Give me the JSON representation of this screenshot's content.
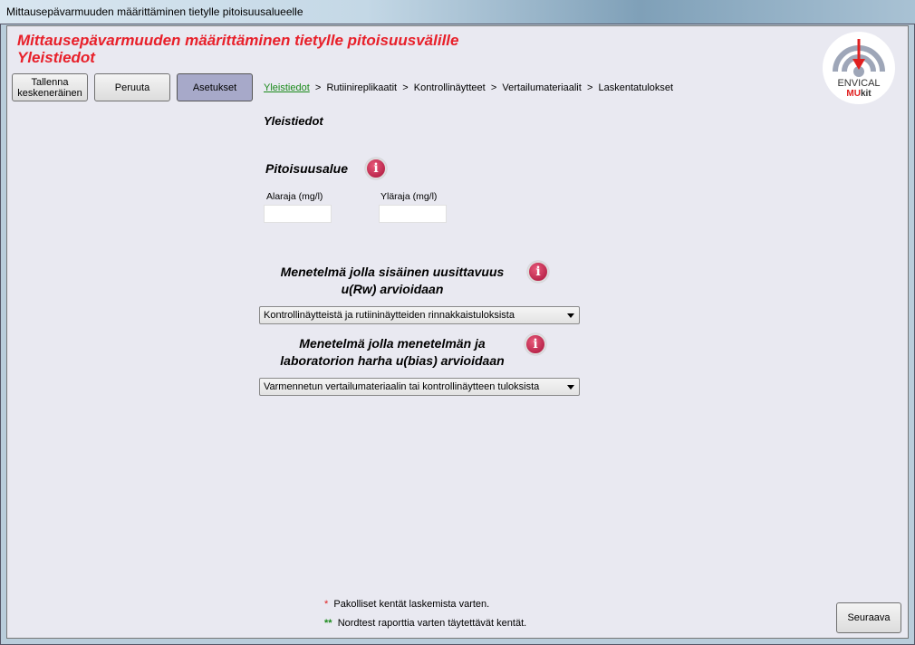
{
  "window": {
    "title": "Mittausepävarmuuden määrittäminen tietylle pitoisuusalueelle"
  },
  "header": {
    "title": "Mittausepävarmuuden määrittäminen tietylle pitoisuusvälille",
    "subtitle": "Yleistiedot"
  },
  "toolbar": {
    "save_line1": "Tallenna",
    "save_line2": "keskeneräinen",
    "cancel": "Peruuta",
    "settings": "Asetukset"
  },
  "breadcrumb": {
    "items": [
      "Yleistiedot",
      "Rutiinireplikaatit",
      "Kontrollinäytteet",
      "Vertailumateriaalit",
      "Laskentatulokset"
    ],
    "separator": ">"
  },
  "logo": {
    "line1": "ENVICAL",
    "line2a": "MU",
    "line2b": "kit"
  },
  "main": {
    "section_title": "Yleistiedot",
    "range": {
      "title": "Pitoisuusalue",
      "lower_label": "Alaraja (mg/l)",
      "upper_label": "Yläraja (mg/l)",
      "lower_value": "",
      "upper_value": ""
    },
    "rw": {
      "title_line1": "Menetelmä jolla sisäinen uusittavuus",
      "title_line2": "u(Rw) arvioidaan",
      "selected": "Kontrollinäytteistä ja rutiininäytteiden rinnakkaistuloksista"
    },
    "bias": {
      "title_line1": "Menetelmä jolla menetelmän ja",
      "title_line2": "laboratorion harha u(bias) arvioidaan",
      "selected": "Varmennetun vertailumateriaalin tai kontrollinäytteen tuloksista"
    },
    "info_glyph": "i"
  },
  "footer": {
    "required_mark": "*",
    "required_text": "Pakolliset kentät laskemista varten.",
    "nordtest_mark": "**",
    "nordtest_text": "Nordtest raporttia varten täytettävät kentät.",
    "next": "Seuraava"
  },
  "colors": {
    "title_red": "#e8202a",
    "active_crumb": "#1a8a1a",
    "settings_button": "#a7a9c9"
  }
}
